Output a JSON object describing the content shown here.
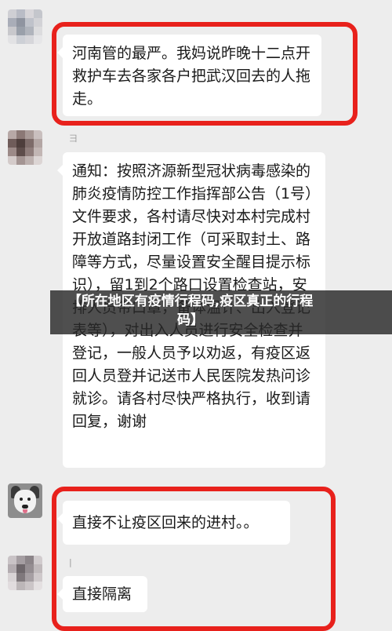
{
  "messages": [
    {
      "sender": "",
      "text": "河南管的最严。我妈说昨晚十二点开救护车去各家各户把武汉回去的人拖走。"
    },
    {
      "sender": "彐",
      "text": "通知：按照济源新型冠状病毒感染的肺炎疫情防控工作指挥部公告（1号）文件要求，各村请尽快对本村完成村开放道路封闭工作（可采取封土、路障等方式，尽量设置安全醒目提示标识），留1到2个路口设置检查站，安排人员带口罩，备体温计、出入登记表等），对出入人员进行安全检查并登记，一般人员予以劝返，有疫区返回人员登并记送市人民医院发热问诊就诊。请各村尽快严格执行，收到请回复，谢谢"
    },
    {
      "sender": "",
      "text": "直接不让疫区回来的进村。。"
    },
    {
      "sender": "|",
      "text": "直接隔离"
    }
  ],
  "overlay_caption": "【所在地区有疫情行程码,疫区真正的行程码】",
  "colors": {
    "highlight": "#e8211c",
    "bubble": "#ffffff",
    "background": "#ededed"
  }
}
